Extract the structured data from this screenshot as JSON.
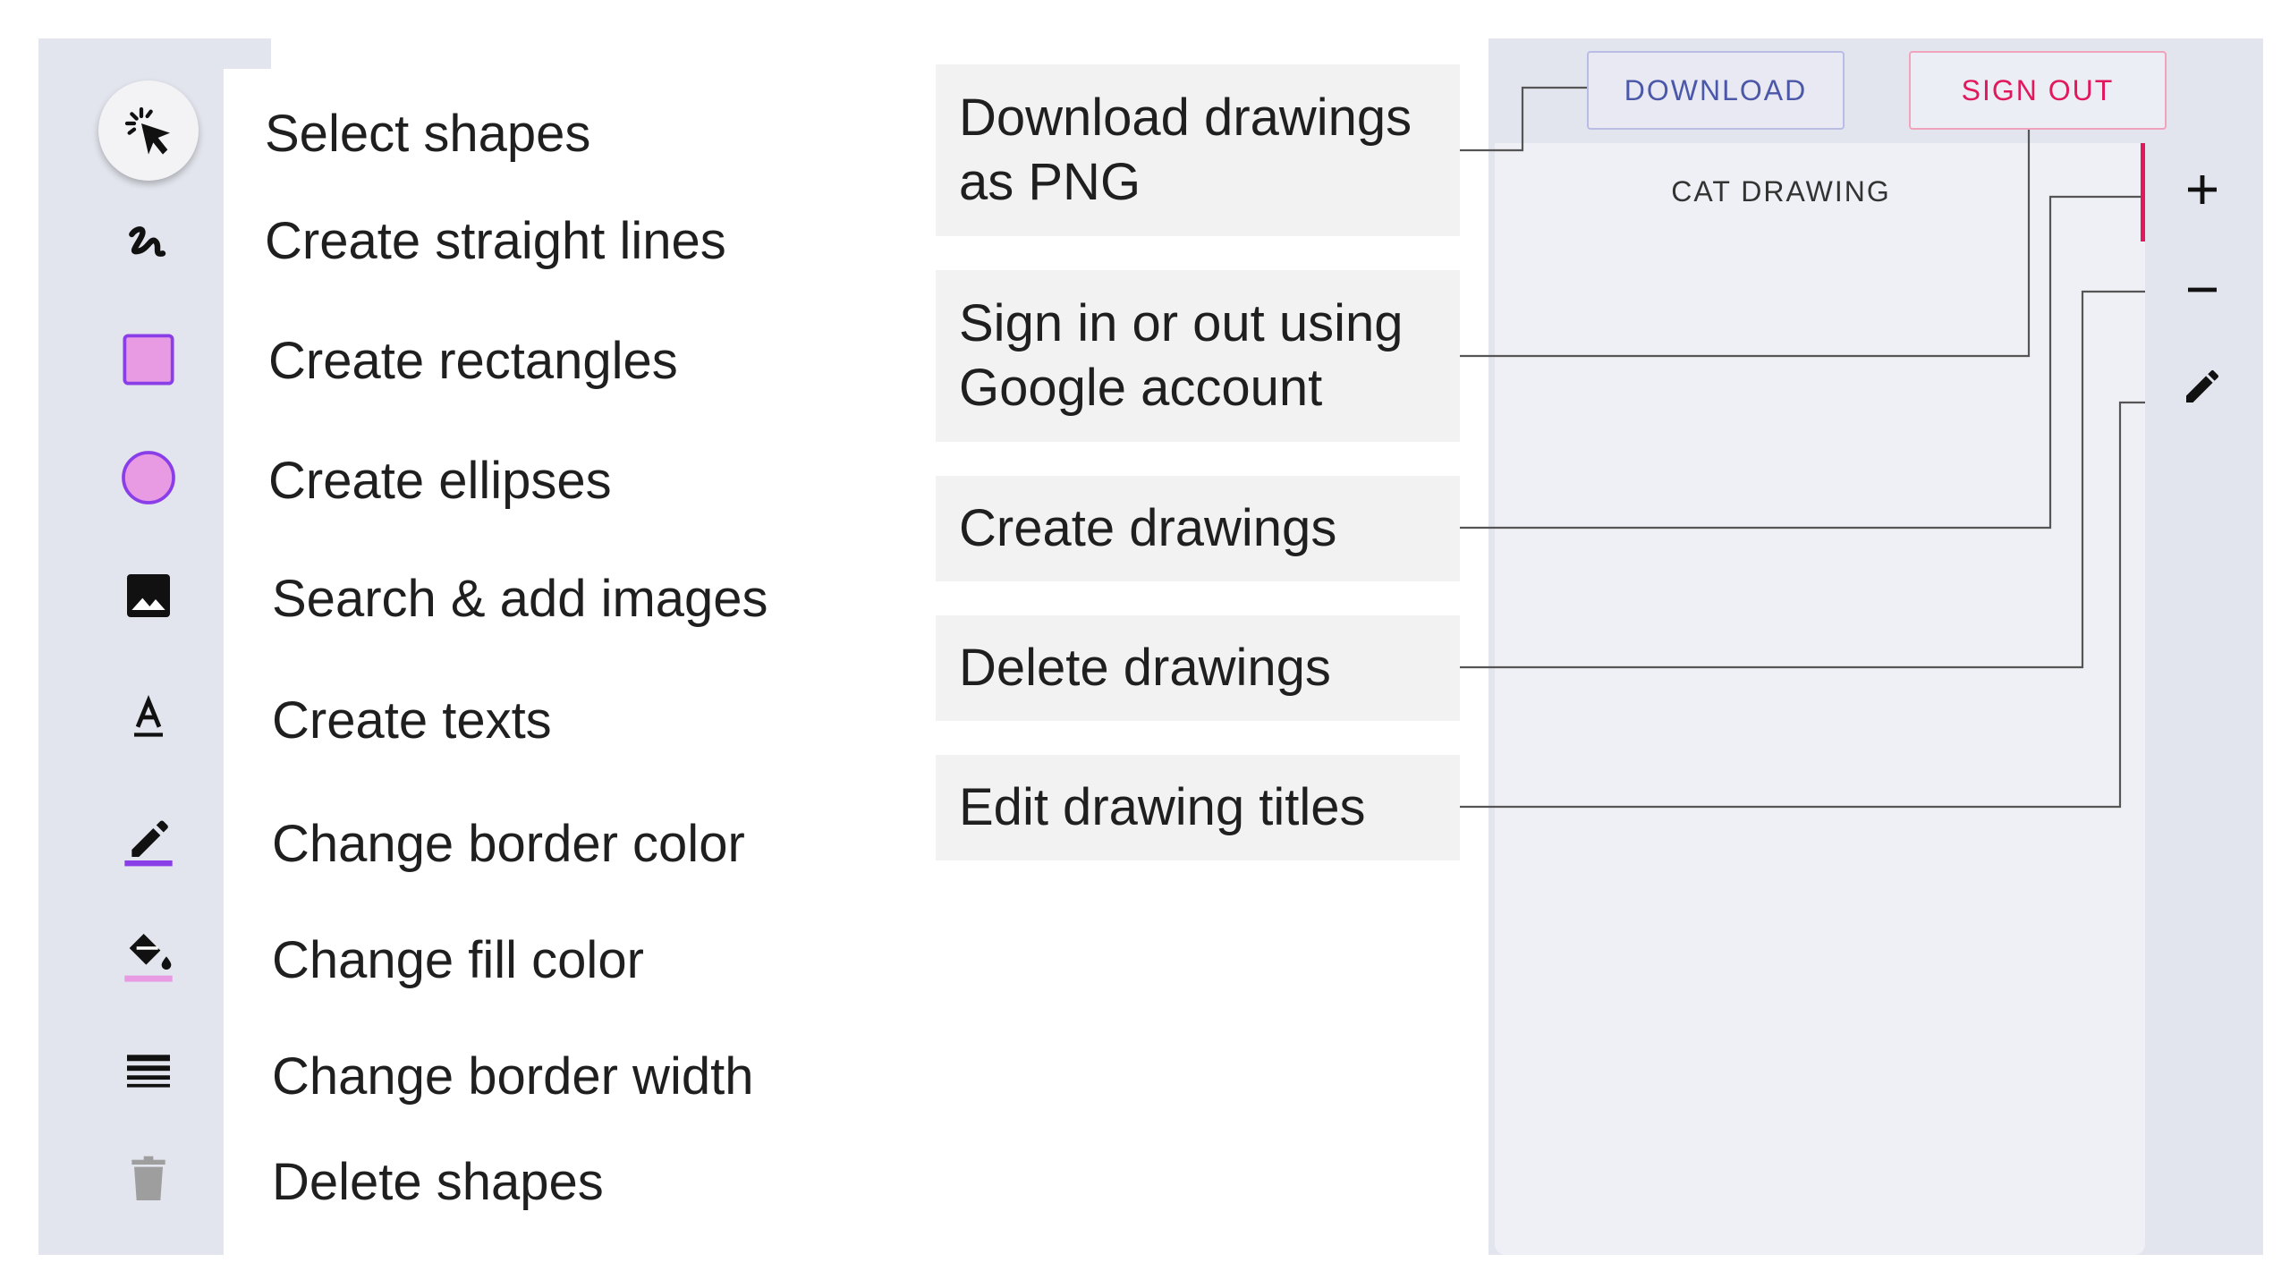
{
  "toolbar": {
    "tools": [
      {
        "label": "Select shapes",
        "icon": "cursor-select-icon"
      },
      {
        "label": "Create straight lines",
        "icon": "squiggle-line-icon"
      },
      {
        "label": "Create rectangles",
        "icon": "rectangle-icon"
      },
      {
        "label": "Create ellipses",
        "icon": "ellipse-icon"
      },
      {
        "label": "Search & add images",
        "icon": "image-icon"
      },
      {
        "label": "Create texts",
        "icon": "text-icon"
      },
      {
        "label": "Change border color",
        "icon": "border-color-icon"
      },
      {
        "label": "Change fill color",
        "icon": "fill-color-icon"
      },
      {
        "label": "Change border width",
        "icon": "line-weight-icon"
      },
      {
        "label": "Delete shapes",
        "icon": "trash-icon"
      }
    ]
  },
  "callouts": {
    "download_line1": "Download drawings",
    "download_line2": "as PNG",
    "signin_line1": "Sign in or out using",
    "signin_line2": "Google account",
    "create": "Create drawings",
    "delete": "Delete drawings",
    "edit": "Edit drawing titles"
  },
  "app": {
    "download_label": "DOWNLOAD",
    "signout_label": "SIGN OUT",
    "drawing_title": "CAT DRAWING",
    "rail": [
      "add-icon",
      "remove-icon",
      "edit-icon"
    ]
  },
  "colors": {
    "accent": "#e2185d",
    "shape_fill": "#e89ae3",
    "shape_border": "#8a3ee8",
    "download_text": "#4b57a8"
  }
}
